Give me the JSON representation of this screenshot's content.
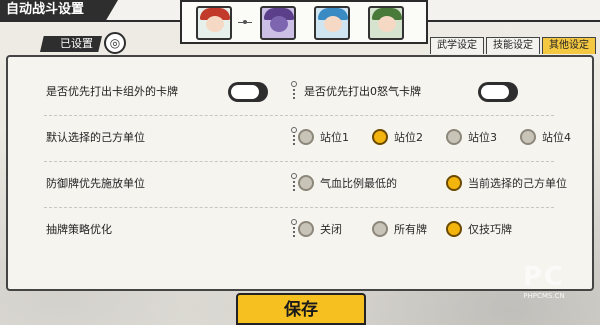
{
  "header": {
    "title": "自动战斗设置",
    "subtitle": "已设置"
  },
  "tabs": [
    {
      "label": "武学设定",
      "active": false
    },
    {
      "label": "技能设定",
      "active": false
    },
    {
      "label": "其他设定",
      "active": true
    }
  ],
  "team": [
    {
      "name": "hero-red-hat-girl",
      "color": "#c23a2a"
    },
    {
      "name": "hero-purple-beast",
      "color": "#5b3f8a"
    },
    {
      "name": "hero-blue-hair",
      "color": "#3a8ac4"
    },
    {
      "name": "hero-green-warrior",
      "color": "#4a7a3a"
    }
  ],
  "settings": {
    "row1": {
      "left_label": "是否优先打出卡组外的卡牌",
      "right_label": "是否优先打出0怒气卡牌",
      "left_toggle": "off",
      "right_toggle": "off"
    },
    "row2": {
      "label": "默认选择的己方单位",
      "options": [
        "站位1",
        "站位2",
        "站位3",
        "站位4"
      ],
      "selected": "站位2"
    },
    "row3": {
      "label": "防御牌优先施放单位",
      "options": [
        "气血比例最低的",
        "当前选择的己方单位"
      ],
      "selected": "当前选择的己方单位"
    },
    "row4": {
      "label": "抽牌策略优化",
      "options": [
        "关闭",
        "所有牌",
        "仅技巧牌"
      ],
      "selected": "仅技巧牌"
    }
  },
  "save_button": "保存",
  "watermark": {
    "big": "PC",
    "small": "PHPCMS.CN"
  },
  "colors": {
    "accent_yellow": "#f4b40e",
    "dark": "#2e2e2e"
  }
}
